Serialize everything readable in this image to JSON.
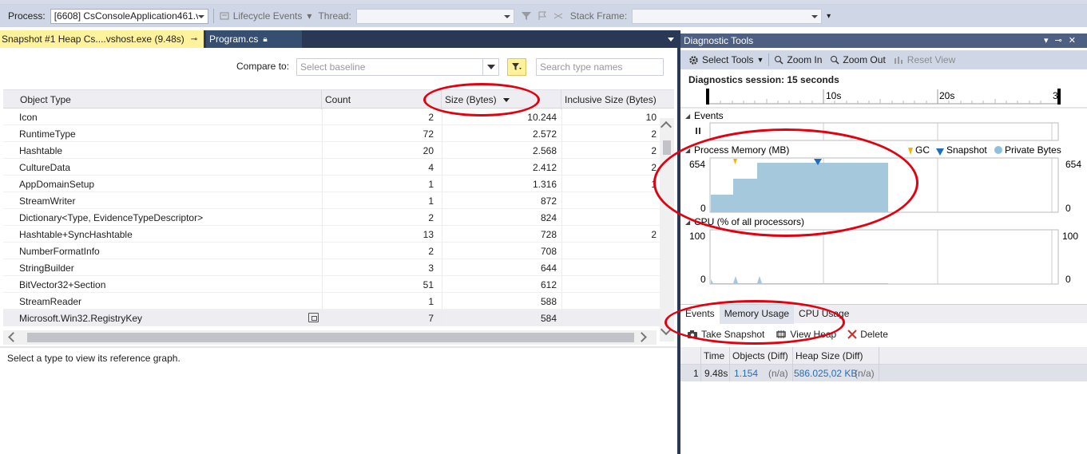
{
  "toolbar": {
    "process_label": "Process:",
    "process_value": "[6608] CsConsoleApplication461.v",
    "lifecycle_label": "Lifecycle Events",
    "thread_label": "Thread:",
    "stack_frame_label": "Stack Frame:"
  },
  "tabs": {
    "active": "Snapshot #1 Heap Cs....vshost.exe (9.48s)",
    "inactive": "Program.cs"
  },
  "compare": {
    "label": "Compare to:",
    "baseline_placeholder": "Select baseline",
    "search_placeholder": "Search type names"
  },
  "grid": {
    "columns": [
      "Object Type",
      "Count",
      "Size (Bytes)",
      "Inclusive Size (Bytes)"
    ],
    "rows": [
      {
        "type": "Icon",
        "count": "2",
        "size": "10.244",
        "incl": "10"
      },
      {
        "type": "RuntimeType",
        "count": "72",
        "size": "2.572",
        "incl": "2"
      },
      {
        "type": "Hashtable",
        "count": "20",
        "size": "2.568",
        "incl": "2"
      },
      {
        "type": "CultureData",
        "count": "4",
        "size": "2.412",
        "incl": "2"
      },
      {
        "type": "AppDomainSetup",
        "count": "1",
        "size": "1.316",
        "incl": "1"
      },
      {
        "type": "StreamWriter",
        "count": "1",
        "size": "872",
        "incl": ""
      },
      {
        "type": "Dictionary<Type, EvidenceTypeDescriptor>",
        "count": "2",
        "size": "824",
        "incl": ""
      },
      {
        "type": "Hashtable+SyncHashtable",
        "count": "13",
        "size": "728",
        "incl": "2"
      },
      {
        "type": "NumberFormatInfo",
        "count": "2",
        "size": "708",
        "incl": ""
      },
      {
        "type": "StringBuilder",
        "count": "3",
        "size": "644",
        "incl": ""
      },
      {
        "type": "BitVector32+Section",
        "count": "51",
        "size": "612",
        "incl": ""
      },
      {
        "type": "StreamReader",
        "count": "1",
        "size": "588",
        "incl": ""
      },
      {
        "type": "Microsoft.Win32.RegistryKey",
        "count": "7",
        "size": "584",
        "incl": ""
      }
    ]
  },
  "reference_graph_hint": "Select a type to view its reference graph.",
  "diag": {
    "title": "Diagnostic Tools",
    "select_tools": "Select Tools",
    "zoom_in": "Zoom In",
    "zoom_out": "Zoom Out",
    "reset_view": "Reset View",
    "session": "Diagnostics session: 15 seconds",
    "ruler": [
      "10s",
      "20s",
      "3"
    ],
    "events_title": "Events",
    "memory_title": "Process Memory (MB)",
    "legend": [
      "GC",
      "Snapshot",
      "Private Bytes"
    ],
    "memory_max": "654",
    "memory_min": "0",
    "cpu_title": "CPU (% of all processors)",
    "cpu_max": "100",
    "cpu_min": "0",
    "bottom_tabs": [
      "Events",
      "Memory Usage",
      "CPU Usage"
    ],
    "take_snapshot": "Take Snapshot",
    "view_heap": "View Heap",
    "delete": "Delete",
    "snap_columns": [
      "Time",
      "Objects (Diff)",
      "Heap Size (Diff)"
    ],
    "snap_row": {
      "index": "1",
      "time": "9.48s",
      "objects": "1.154",
      "objects_diff": "(n/a)",
      "heap": "586.025,02 KB",
      "heap_diff": "(n/a)"
    }
  },
  "colors": {
    "memory_fill": "#a6c8dc",
    "gc_marker": "#f5b400",
    "snapshot_marker": "#1e6dc0",
    "annotation": "#e3000f"
  }
}
